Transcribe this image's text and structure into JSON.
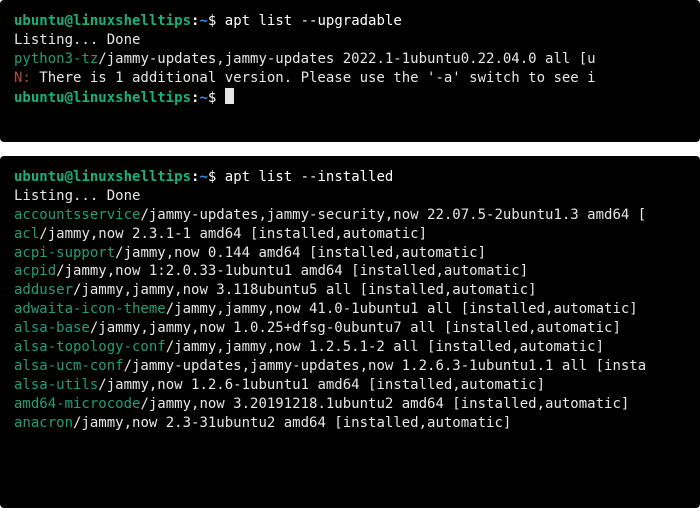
{
  "prompt": {
    "user": "ubuntu",
    "at": "@",
    "host": "linuxshelltips",
    "colon": ":",
    "path": "~",
    "dollar": "$ "
  },
  "block1": {
    "command": "apt list --upgradable",
    "listing": "Listing... Done",
    "line1": {
      "pkg": "python3-tz",
      "rest": "/jammy-updates,jammy-updates 2022.1-1ubuntu0.22.04.0 all [u"
    },
    "note": {
      "tag": "N:",
      "text": " There is 1 additional version. Please use the '-a' switch to see i"
    }
  },
  "block2": {
    "command": "apt list --installed",
    "listing": "Listing... Done",
    "entries": [
      {
        "pkg": "accountsservice",
        "rest": "/jammy-updates,jammy-security,now 22.07.5-2ubuntu1.3 amd64 ["
      },
      {
        "pkg": "acl",
        "rest": "/jammy,now 2.3.1-1 amd64 [installed,automatic]"
      },
      {
        "pkg": "acpi-support",
        "rest": "/jammy,now 0.144 amd64 [installed,automatic]"
      },
      {
        "pkg": "acpid",
        "rest": "/jammy,now 1:2.0.33-1ubuntu1 amd64 [installed,automatic]"
      },
      {
        "pkg": "adduser",
        "rest": "/jammy,jammy,now 3.118ubuntu5 all [installed,automatic]"
      },
      {
        "pkg": "adwaita-icon-theme",
        "rest": "/jammy,jammy,now 41.0-1ubuntu1 all [installed,automatic]"
      },
      {
        "pkg": "alsa-base",
        "rest": "/jammy,jammy,now 1.0.25+dfsg-0ubuntu7 all [installed,automatic]"
      },
      {
        "pkg": "alsa-topology-conf",
        "rest": "/jammy,jammy,now 1.2.5.1-2 all [installed,automatic]"
      },
      {
        "pkg": "alsa-ucm-conf",
        "rest": "/jammy-updates,jammy-updates,now 1.2.6.3-1ubuntu1.1 all [insta"
      },
      {
        "pkg": "alsa-utils",
        "rest": "/jammy,now 1.2.6-1ubuntu1 amd64 [installed,automatic]"
      },
      {
        "pkg": "amd64-microcode",
        "rest": "/jammy,now 3.20191218.1ubuntu2 amd64 [installed,automatic]"
      },
      {
        "pkg": "anacron",
        "rest": "/jammy,now 2.3-31ubuntu2 amd64 [installed,automatic]"
      }
    ]
  }
}
